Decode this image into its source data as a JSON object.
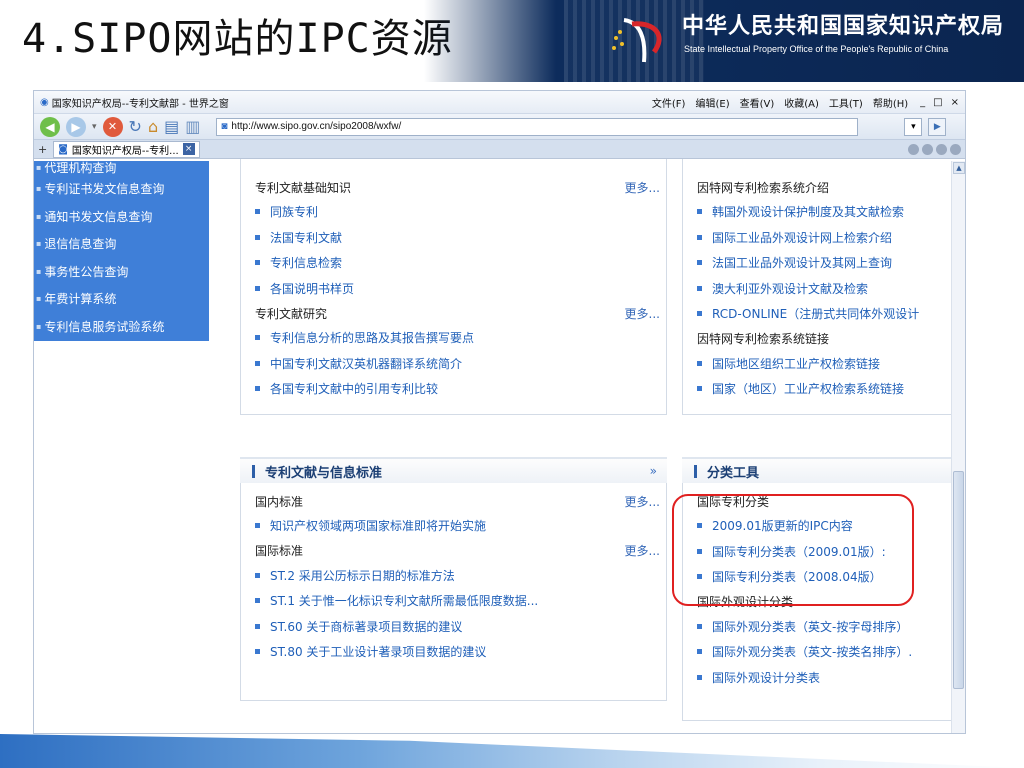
{
  "slide": {
    "title": "4.SIPO网站的IPC资源",
    "org_cn": "中华人民共和国国家知识产权局",
    "org_en": "State Intellectual Property Office of the People's Republic of China"
  },
  "browser": {
    "window_title": "国家知识产权局--专利文献部 - 世界之窗",
    "menu": [
      "文件(F)",
      "编辑(E)",
      "查看(V)",
      "收藏(A)",
      "工具(T)",
      "帮助(H)"
    ],
    "window_controls": [
      "_",
      "□",
      "×"
    ],
    "address_url": "http://www.sipo.gov.cn/sipo2008/wxfw/",
    "tab_label": "国家知识产权局--专利...",
    "tab_close": "×",
    "tab_add": "+"
  },
  "sidebar": {
    "items": [
      "代理机构查询",
      "专利证书发文信息查询",
      "通知书发文信息查询",
      "退信信息查询",
      "事务性公告查询",
      "年费计算系统",
      "专利信息服务试验系统"
    ]
  },
  "top_left_panel": {
    "sec1_title": "专利文献基础知识",
    "sec1_more": "更多...",
    "sec1_links": [
      "同族专利",
      "法国专利文献",
      "专利信息检索",
      "各国说明书样页"
    ],
    "sec2_title": "专利文献研究",
    "sec2_more": "更多...",
    "sec2_links": [
      "专利信息分析的思路及其报告撰写要点",
      "中国专利文献汉英机器翻译系统简介",
      "各国专利文献中的引用专利比较"
    ]
  },
  "top_right_panel": {
    "sec1_title": "因特网专利检索系统介绍",
    "sec1_links": [
      "韩国外观设计保护制度及其文献检索",
      "国际工业品外观设计网上检索介绍",
      "法国工业品外观设计及其网上查询",
      "澳大利亚外观设计文献及检索",
      "RCD-ONLINE（注册式共同体外观设计"
    ],
    "sec2_title": "因特网专利检索系统链接",
    "sec2_links": [
      "国际地区组织工业产权检索链接",
      "国家（地区）工业产权检索系统链接"
    ]
  },
  "standards_panel": {
    "header": "专利文献与信息标准",
    "chevron": "»",
    "sec1_title": "国内标准",
    "sec1_more": "更多...",
    "sec1_links": [
      "知识产权领域两项国家标准即将开始实施"
    ],
    "sec2_title": "国际标准",
    "sec2_more": "更多...",
    "sec2_links": [
      "ST.2 采用公历标示日期的标准方法",
      "ST.1 关于惟一化标识专利文献所需最低限度数据...",
      "ST.60 关于商标著录项目数据的建议",
      "ST.80 关于工业设计著录项目数据的建议"
    ]
  },
  "classification_panel": {
    "header": "分类工具",
    "sec1_title": "国际专利分类",
    "sec1_links": [
      "2009.01版更新的IPC内容",
      "国际专利分类表（2009.01版）:",
      "国际专利分类表（2008.04版）"
    ],
    "sec2_title": "国际外观设计分类",
    "sec2_links": [
      "国际外观分类表（英文-按字母排序）",
      "国际外观分类表（英文-按类名排序）.",
      "国际外观设计分类表"
    ]
  },
  "colors": {
    "sidebar_bg": "#3f7fd8",
    "link": "#1f5fb8",
    "highlight": "#e02020",
    "banner": "#0d2c5c"
  }
}
